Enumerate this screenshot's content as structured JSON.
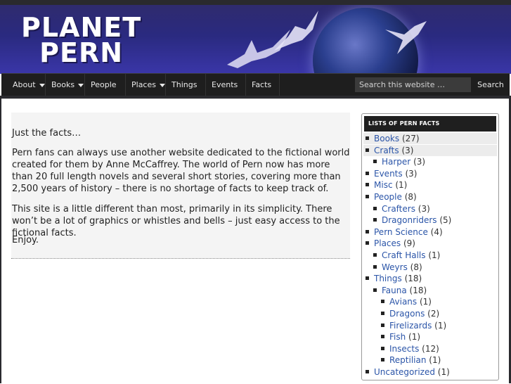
{
  "site": {
    "logo_line1": "PLANET",
    "logo_line2": "PERN"
  },
  "nav": {
    "items": [
      {
        "label": "About"
      },
      {
        "label": "Books"
      },
      {
        "label": "People"
      },
      {
        "label": "Places"
      },
      {
        "label": "Things"
      },
      {
        "label": "Events"
      },
      {
        "label": "Facts"
      }
    ],
    "search_placeholder": "Search this website …",
    "search_button": "Search"
  },
  "post": {
    "p1": "Just the facts…",
    "p2": "Pern fans can always use another website dedicated to the fictional world created for them by Anne McCaffrey. The world of Pern now has more than 20 full length novels and several short stories, covering more than 2,500 years of history – there is no shortage of facts to keep track of.",
    "p3": "This site is a little different than most, primarily in its simplicity.  There won’t be a lot of graphics or whistles and bells – just easy access to the fictional facts.",
    "p4": "Enjoy."
  },
  "sidebar": {
    "title": "LISTS OF PERN FACTS",
    "categories": [
      {
        "name": "Books",
        "count": "(27)"
      },
      {
        "name": "Crafts",
        "count": "(3)"
      },
      {
        "name": "Harper",
        "count": "(3)"
      },
      {
        "name": "Events",
        "count": "(3)"
      },
      {
        "name": "Misc",
        "count": "(1)"
      },
      {
        "name": "People",
        "count": "(8)"
      },
      {
        "name": "Crafters",
        "count": "(3)"
      },
      {
        "name": "Dragonriders",
        "count": "(5)"
      },
      {
        "name": "Pern Science",
        "count": "(4)"
      },
      {
        "name": "Places",
        "count": "(9)"
      },
      {
        "name": "Craft Halls",
        "count": "(1)"
      },
      {
        "name": "Weyrs",
        "count": "(8)"
      },
      {
        "name": "Things",
        "count": "(18)"
      },
      {
        "name": "Fauna",
        "count": "(18)"
      },
      {
        "name": "Avians",
        "count": "(1)"
      },
      {
        "name": "Dragons",
        "count": "(2)"
      },
      {
        "name": "Firelizards",
        "count": "(1)"
      },
      {
        "name": "Fish",
        "count": "(1)"
      },
      {
        "name": "Insects",
        "count": "(12)"
      },
      {
        "name": "Reptilian",
        "count": "(1)"
      },
      {
        "name": "Uncategorized",
        "count": "(1)"
      }
    ]
  },
  "colors": {
    "header_bg": "#2a2a80",
    "nav_bg": "#1e1e1e",
    "link": "#2b55a8"
  }
}
